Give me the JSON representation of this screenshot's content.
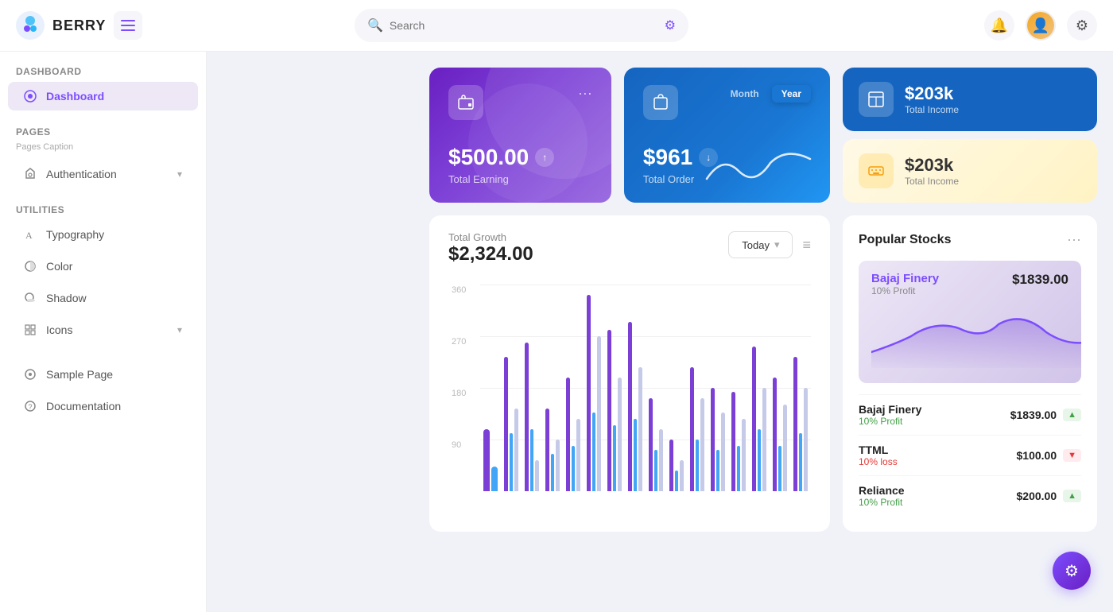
{
  "app": {
    "name": "BERRY"
  },
  "topbar": {
    "search_placeholder": "Search",
    "hamburger_label": "Toggle menu"
  },
  "sidebar": {
    "section_dashboard": "Dashboard",
    "active_item": "Dashboard",
    "section_pages": "Pages",
    "pages_caption": "Pages Caption",
    "item_authentication": "Authentication",
    "section_utilities": "Utilities",
    "item_typography": "Typography",
    "item_color": "Color",
    "item_shadow": "Shadow",
    "item_icons": "Icons",
    "item_sample": "Sample Page",
    "item_documentation": "Documentation"
  },
  "cards": {
    "total_earning_amount": "$500.00",
    "total_earning_label": "Total Earning",
    "toggle_month": "Month",
    "toggle_year": "Year",
    "total_order_amount": "$961",
    "total_order_label": "Total Order",
    "total_income_1_amount": "$203k",
    "total_income_1_label": "Total Income",
    "total_income_2_amount": "$203k",
    "total_income_2_label": "Total Income"
  },
  "chart": {
    "label": "Total Growth",
    "amount": "$2,324.00",
    "today_btn": "Today",
    "y_axis": [
      "360",
      "270",
      "180",
      "90"
    ],
    "bars": [
      {
        "purple": 30,
        "blue": 12,
        "light": 0
      },
      {
        "purple": 65,
        "blue": 28,
        "light": 40
      },
      {
        "purple": 72,
        "blue": 30,
        "light": 15
      },
      {
        "purple": 40,
        "blue": 18,
        "light": 25
      },
      {
        "purple": 55,
        "blue": 22,
        "light": 35
      },
      {
        "purple": 95,
        "blue": 38,
        "light": 75
      },
      {
        "purple": 78,
        "blue": 32,
        "light": 55
      },
      {
        "purple": 82,
        "blue": 35,
        "light": 60
      },
      {
        "purple": 45,
        "blue": 20,
        "light": 30
      },
      {
        "purple": 25,
        "blue": 10,
        "light": 15
      },
      {
        "purple": 60,
        "blue": 25,
        "light": 45
      },
      {
        "purple": 50,
        "blue": 20,
        "light": 38
      },
      {
        "purple": 48,
        "blue": 22,
        "light": 35
      },
      {
        "purple": 70,
        "blue": 30,
        "light": 50
      },
      {
        "purple": 55,
        "blue": 22,
        "light": 42
      },
      {
        "purple": 65,
        "blue": 28,
        "light": 50
      }
    ]
  },
  "stocks": {
    "title": "Popular Stocks",
    "featured": {
      "name": "Bajaj Finery",
      "profit_label": "10% Profit",
      "price": "$1839.00"
    },
    "list": [
      {
        "name": "Bajaj Finery",
        "profit": "10% Profit",
        "profit_positive": true,
        "price": "$1839.00"
      },
      {
        "name": "TTML",
        "profit": "10% loss",
        "profit_positive": false,
        "price": "$100.00"
      },
      {
        "name": "Reliance",
        "profit": "10% Profit",
        "profit_positive": true,
        "price": "$200.00"
      }
    ]
  },
  "colors": {
    "purple_primary": "#7c4dff",
    "purple_dark": "#6a1fc2",
    "blue_primary": "#1976d2",
    "bar_purple": "#7c3fd6",
    "bar_blue": "#42a5f5",
    "bar_light": "#c5cae9"
  }
}
